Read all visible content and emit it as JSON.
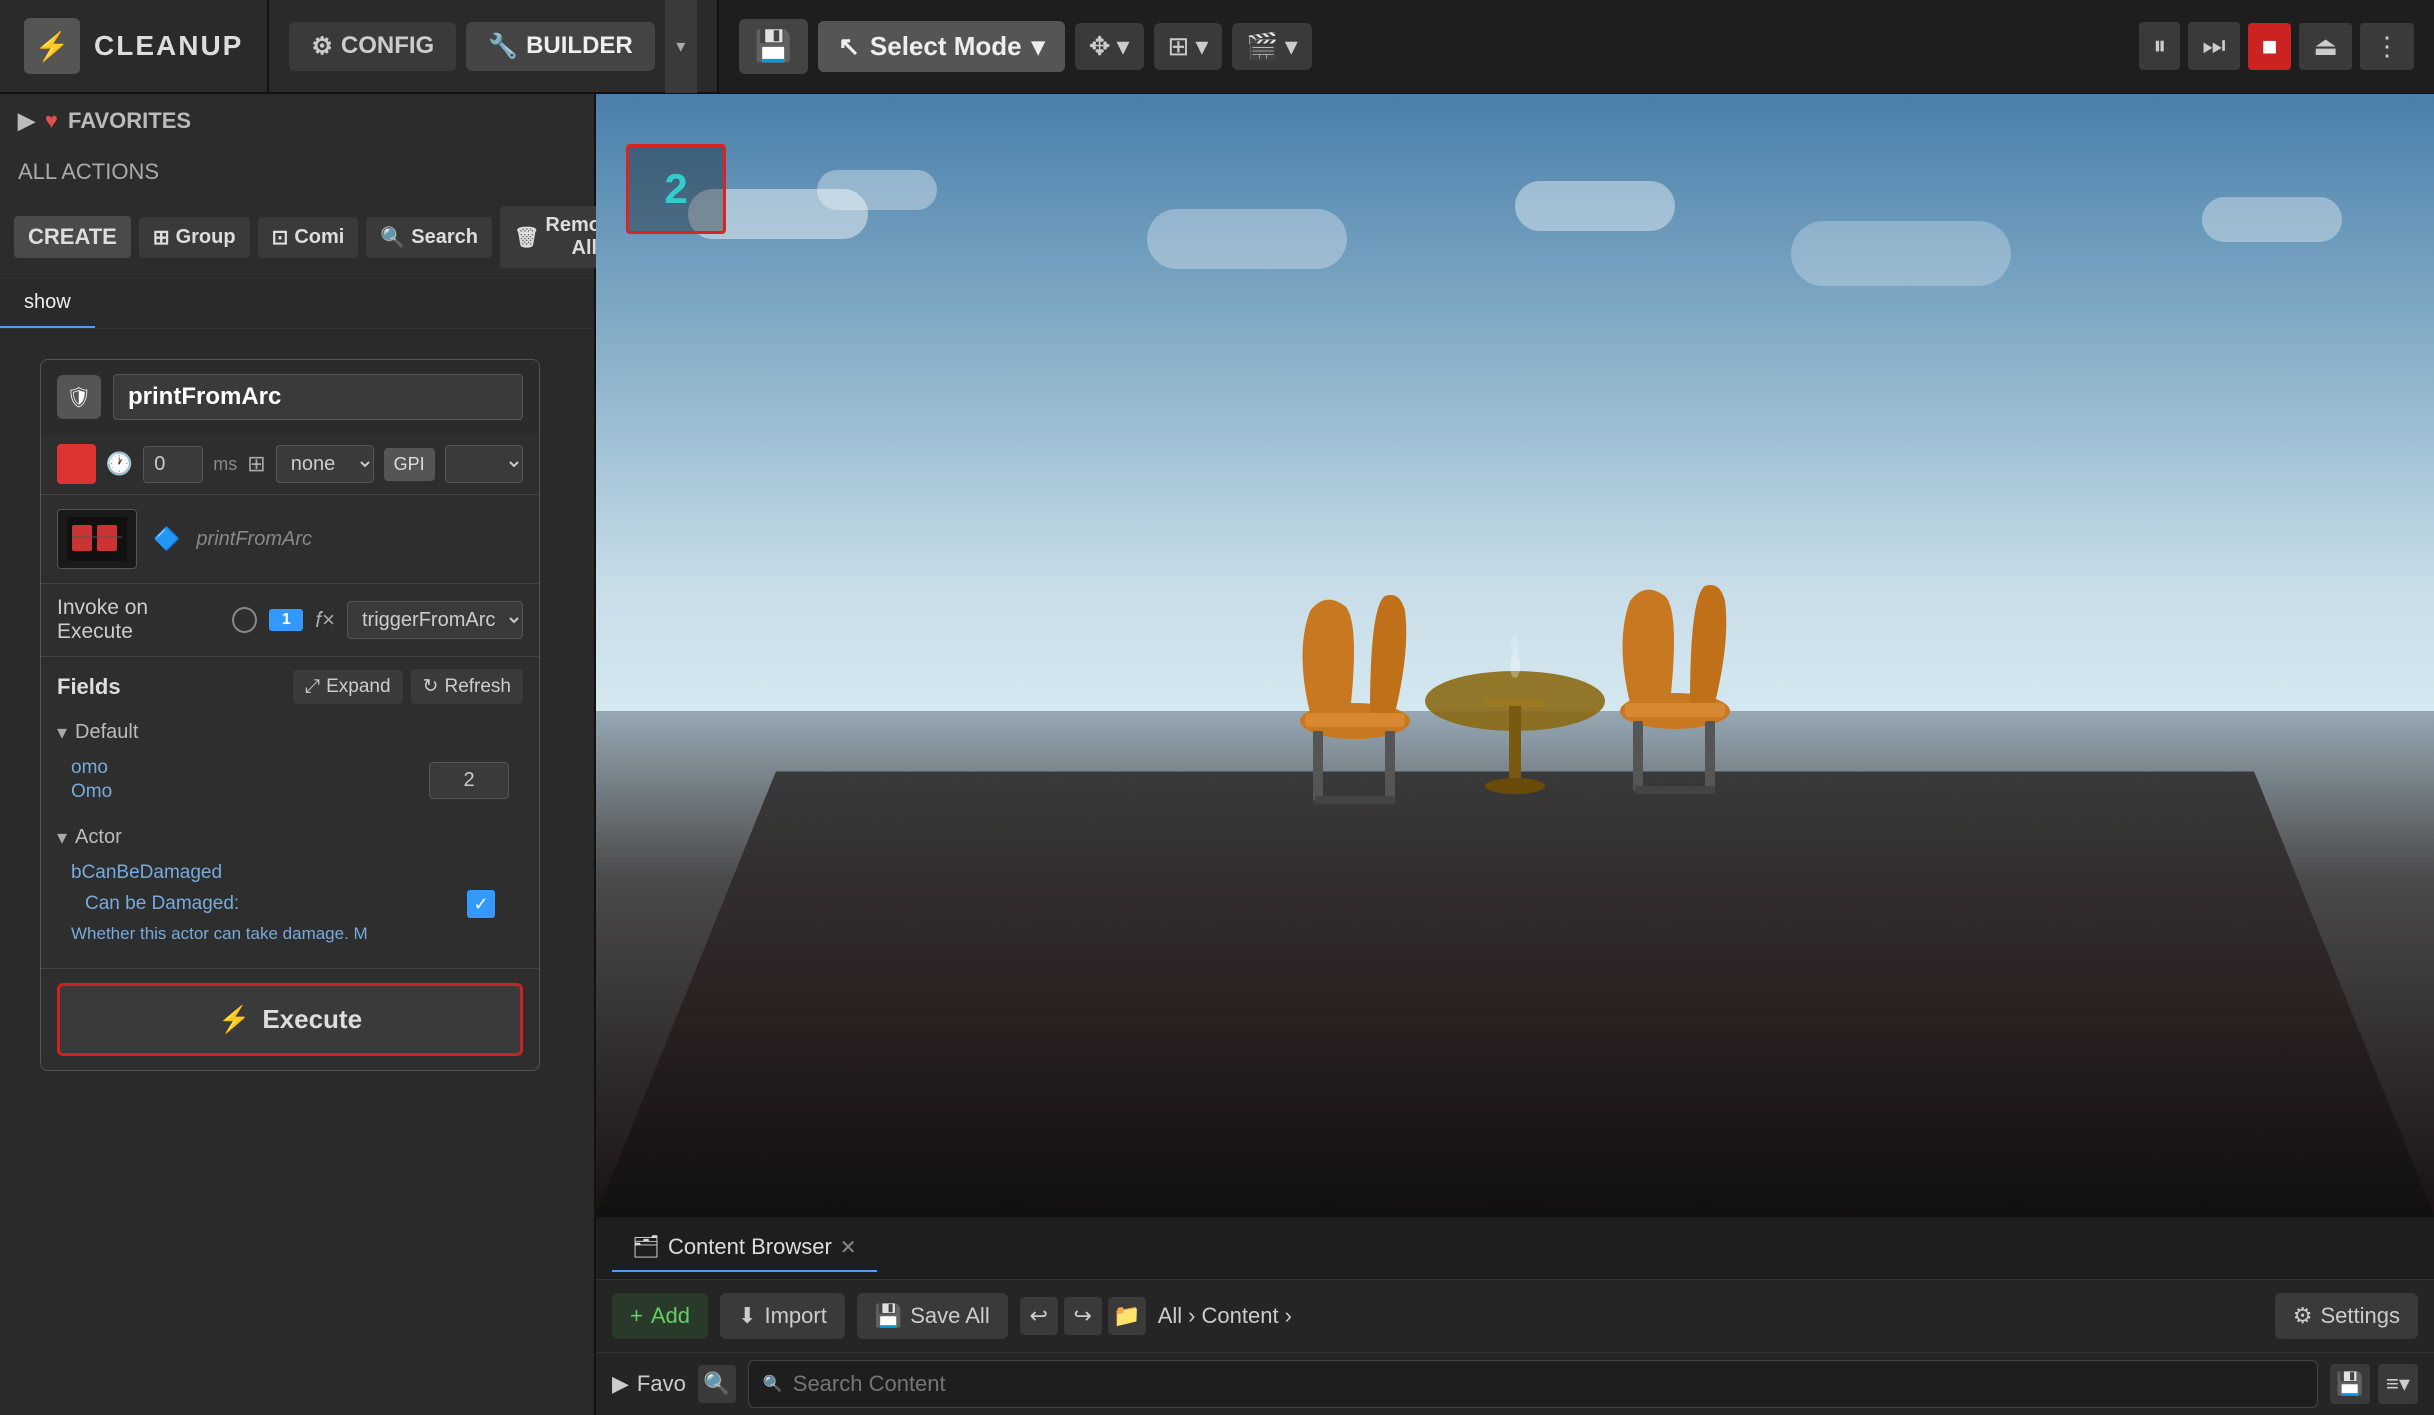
{
  "app": {
    "title": "CLEANUP",
    "icon": "⚡"
  },
  "topbar": {
    "config_label": "CONFIG",
    "builder_label": "BUILDER",
    "config_icon": "⚙️",
    "builder_icon": "🔧"
  },
  "viewport": {
    "select_mode_label": "Select Mode",
    "save_icon": "💾",
    "selection_number": "2"
  },
  "left_panel": {
    "favorites_label": "FAVORITES",
    "all_actions_label": "ALL ACTIONS",
    "create_label": "CREATE",
    "group_label": "Group",
    "command_label": "Comi",
    "search_label": "Search",
    "remove_all_label": "Remove All",
    "tab_show": "show",
    "node": {
      "title": "printFromArc",
      "time_value": "0",
      "time_unit": "ms",
      "grid_value": "none",
      "gpi_label": "GPI",
      "ref_name": "printFromArc",
      "invoke_label": "Invoke on Execute",
      "trigger_value": "triggerFromArc",
      "fields_label": "Fields",
      "expand_label": "Expand",
      "refresh_label": "Refresh",
      "default_group": "Default",
      "field_omo": "omo",
      "field_omo_display": "Omo",
      "field_omo_value": "2",
      "actor_group": "Actor",
      "bcan_name": "bCanBeDamaged",
      "bcan_label": "Can be Damaged:",
      "bcan_desc": "Whether this actor can take damage. M"
    },
    "execute_label": "Execute"
  },
  "content_browser": {
    "tab_label": "Content Browser",
    "add_label": "Add",
    "import_label": "Import",
    "save_all_label": "Save All",
    "all_label": "All",
    "content_label": "Content",
    "settings_label": "Settings",
    "favorites_label": "Favo",
    "search_placeholder": "Search Content"
  },
  "icons": {
    "gear": "⚙",
    "puzzle": "🔧",
    "chevron_down": "▾",
    "chevron_right": "▶",
    "triangle_down": "▾",
    "play": "▶",
    "pause": "⏸",
    "stop": "■",
    "eject": "⏏",
    "step": "⏭",
    "more": "⋮",
    "save": "💾",
    "group": "⊞",
    "search": "🔍",
    "trash": "🗑",
    "upload": "⬆",
    "folder": "📁",
    "expand": "⤢",
    "refresh": "↻",
    "execute": "⚡",
    "fx": "𝑓",
    "settings": "⚙",
    "arrow_left": "←",
    "arrow_right": "→",
    "arrow_back": "↩",
    "arrow_fwd": "↪",
    "camera": "🎬",
    "cursor": "↖",
    "add": "+"
  }
}
